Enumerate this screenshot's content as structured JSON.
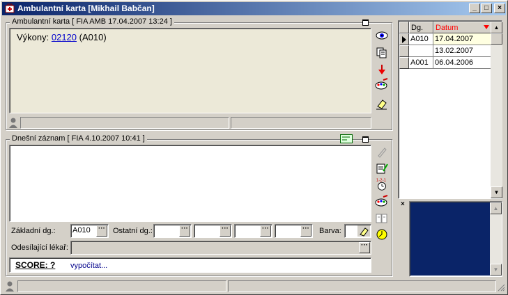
{
  "window": {
    "title": "Ambulantní karta [Mikhail Babčan]",
    "controls": {
      "minimize": "_",
      "maximize": "□",
      "close": "×"
    }
  },
  "ambulantni_karta": {
    "title_underlined": "Ambulantní karta",
    "title_rest": " [ FIA AMB 17.04.2007 13:24 ]",
    "vykony_label": "Výkony: ",
    "vykony_code": "02120",
    "vykony_dg": " (A010)"
  },
  "dnesni_zaznam": {
    "title_underlined": "Dnešní záznam",
    "title_rest": " [ FIA 4.10.2007 10:41 ]",
    "zakladni_dg_label": "Základní dg.:",
    "zakladni_dg_value": "A010",
    "ostatni_dg_label": "Ostatní dg.:",
    "barva_label": "Barva:",
    "odesilajici_label": "Odesílající lékař:",
    "odesilajici_value": "",
    "score_label": "SCORE: ?",
    "vypocitat_label": "vypočítat..."
  },
  "grid": {
    "columns": [
      "Dg.",
      "Datum"
    ],
    "rows": [
      {
        "dg": "A010",
        "datum": "17.04.2007",
        "selected": true
      },
      {
        "dg": "",
        "datum": "13.02.2007",
        "selected": false
      },
      {
        "dg": "A001",
        "datum": "06.04.2006",
        "selected": false
      }
    ],
    "datum_color": "#ff0000"
  },
  "preview_color": "#0a2468",
  "ellipsis": "···"
}
